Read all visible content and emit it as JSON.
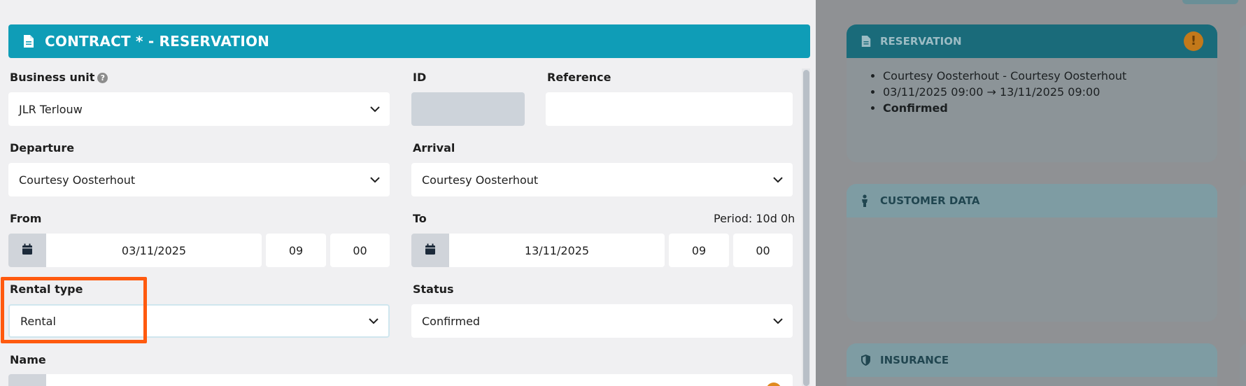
{
  "header": {
    "title": "CONTRACT * - RESERVATION"
  },
  "form": {
    "business_unit": {
      "label": "Business unit",
      "value": "JLR Terlouw"
    },
    "id": {
      "label": "ID",
      "value": ""
    },
    "reference": {
      "label": "Reference",
      "value": ""
    },
    "departure": {
      "label": "Departure",
      "value": "Courtesy Oosterhout"
    },
    "arrival": {
      "label": "Arrival",
      "value": "Courtesy Oosterhout"
    },
    "from": {
      "label": "From",
      "date": "03/11/2025",
      "hour": "09",
      "minute": "00"
    },
    "to": {
      "label": "To",
      "date": "13/11/2025",
      "hour": "09",
      "minute": "00"
    },
    "period": "Period: 10d 0h",
    "rental_type": {
      "label": "Rental type",
      "value": "Rental"
    },
    "status": {
      "label": "Status",
      "value": "Confirmed"
    },
    "name": {
      "label": "Name"
    }
  },
  "side_panel": {
    "reservation": {
      "title": "RESERVATION",
      "items": [
        "Courtesy Oosterhout - Courtesy Oosterhout",
        "03/11/2025 09:00 → 13/11/2025 09:00",
        "Confirmed"
      ]
    },
    "customer": {
      "title": "CUSTOMER DATA"
    },
    "insurance": {
      "title": "INSURANCE"
    }
  },
  "colors": {
    "header_teal": "#0f9db7",
    "highlight_orange": "#ff5a0f",
    "warning": "#e08a1e"
  },
  "icons": [
    "document-icon",
    "help-icon",
    "chevron-down-icon",
    "calendar-icon",
    "warning-icon",
    "person-icon",
    "shield-icon"
  ]
}
